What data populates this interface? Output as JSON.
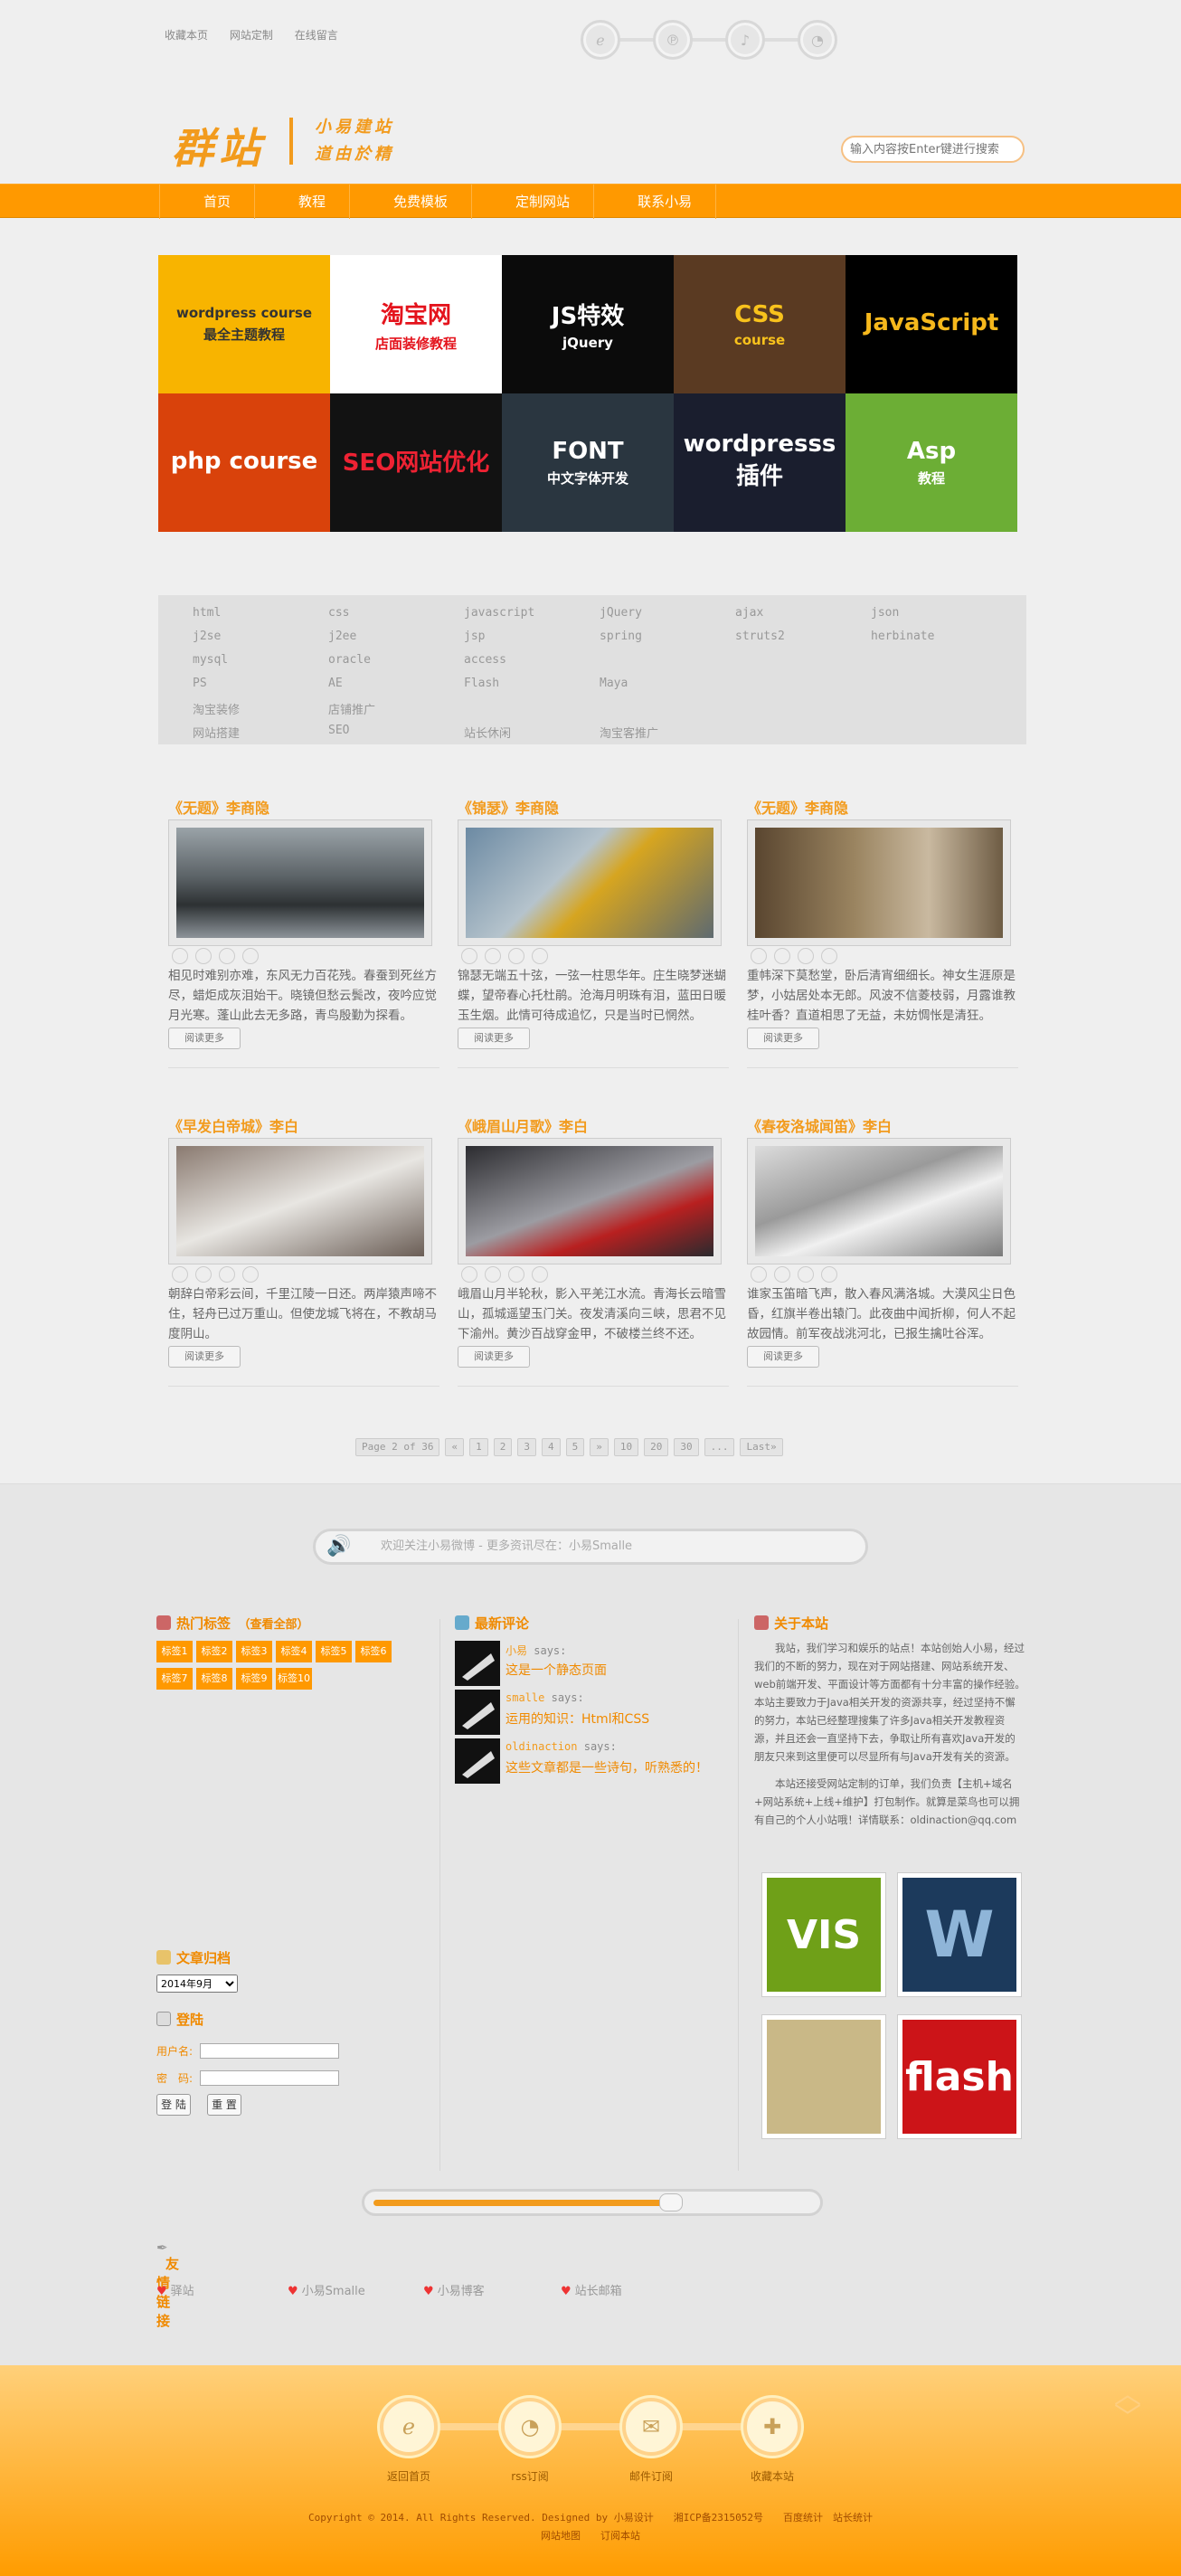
{
  "top_links": [
    "收藏本页",
    "网站定制",
    "在线留言"
  ],
  "top_icons": [
    "ie-icon",
    "p-icon",
    "bell-icon",
    "rss-icon"
  ],
  "logo": {
    "big": "群站",
    "line1": "小易建站",
    "line2": "道由於精"
  },
  "search": {
    "placeholder": "输入内容按Enter键进行搜索"
  },
  "nav": [
    "首页",
    "教程",
    "免费模板",
    "定制网站",
    "联系小易"
  ],
  "tiles": [
    {
      "l1": "wordpress course",
      "l2": "最全主题教程",
      "bg": "#f8b400",
      "fg": "#333"
    },
    {
      "l1": "淘宝网",
      "l2": "店面装修教程",
      "bg": "#ffffff",
      "fg": "#e4131c"
    },
    {
      "l1": "JS特效",
      "l2": "jQuery",
      "bg": "#0b0b0b",
      "fg": "#ffffff"
    },
    {
      "l1": "CSS",
      "l2": "course",
      "bg": "#5a3a22",
      "fg": "#f8c21c"
    },
    {
      "l1": "JavaScript",
      "l2": "",
      "bg": "#000000",
      "fg": "#f6b81c"
    },
    {
      "l1": "php course",
      "l2": "",
      "bg": "#d9420b",
      "fg": "#ffffff"
    },
    {
      "l1": "SEO网站优化",
      "l2": "",
      "bg": "#121212",
      "fg": "#e23"
    },
    {
      "l1": "FONT",
      "l2": "中文字体开发",
      "bg": "#2a3640",
      "fg": "#ffffff"
    },
    {
      "l1": "wordpresss插件",
      "l2": "",
      "bg": "#1a1e2e",
      "fg": "#ffffff"
    },
    {
      "l1": "Asp",
      "l2": "教程",
      "bg": "#6cae35",
      "fg": "#ffffff"
    }
  ],
  "tag_rows": [
    [
      "html",
      "css",
      "javascript",
      "jQuery",
      "ajax",
      "json"
    ],
    [
      "j2se",
      "j2ee",
      "jsp",
      "spring",
      "struts2",
      "herbinate"
    ],
    [
      "mysql",
      "oracle",
      "access",
      "",
      "",
      ""
    ],
    [
      "PS",
      "AE",
      "Flash",
      "Maya",
      "",
      ""
    ],
    [
      "淘宝装修",
      "店铺推广",
      "",
      "",
      "",
      ""
    ],
    [
      "网站搭建",
      "SEO",
      "站长休闲",
      "淘宝客推广",
      "",
      ""
    ]
  ],
  "posts": [
    {
      "title": "《无题》李商隐",
      "excerpt": "相见时难别亦难，东风无力百花残。春蚕到死丝方尽，蜡炬成灰泪始干。晓镜但愁云鬓改，夜吟应觉月光寒。蓬山此去无多路，青鸟殷勤为探看。",
      "more": "阅读更多",
      "img": "linear-gradient(#9aa3a8,#5b6266 45%,#2d3133 70%,#8d949a)"
    },
    {
      "title": "《锦瑟》李商隐",
      "excerpt": "锦瑟无端五十弦，一弦一柱思华年。庄生晓梦迷蝴蝶，望帝春心托杜鹃。沧海月明珠有泪，蓝田日暖玉生烟。此情可待成追忆，只是当时已惘然。",
      "more": "阅读更多",
      "img": "linear-gradient(135deg,#6c8aa3,#b5c3cc 40%,#d6a520 55%,#5e6a70)"
    },
    {
      "title": "《无题》李商隐",
      "excerpt": "重帏深下莫愁堂，卧后清宵细细长。神女生涯原是梦，小姑居处本无郎。风波不信菱枝弱，月露谁教桂叶香？直道相思了无益，未妨惆怅是清狂。",
      "more": "阅读更多",
      "img": "linear-gradient(90deg,#5a4630,#9a8460 40%,#c9b9a0 70%,#6e5c44)"
    },
    {
      "title": "《早发白帝城》李白",
      "excerpt": "朝辞白帝彩云间，千里江陵一日还。两岸猿声啼不住，轻舟已过万重山。但使龙城飞将在，不教胡马度阴山。",
      "more": "阅读更多",
      "img": "linear-gradient(160deg,#8a7a70,#e8e6e2 50%,#6b5e56)"
    },
    {
      "title": "《峨眉山月歌》李白",
      "excerpt": "峨眉山月半轮秋，影入平羌江水流。青海长云暗雪山，孤城遥望玉门关。夜发清溪向三峡，思君不见下渝州。黄沙百战穿金甲，不破楼兰终不还。",
      "more": "阅读更多",
      "img": "linear-gradient(160deg,#2c2c30,#9c9ca2 50%,#b82020 70%,#2a2a2e)"
    },
    {
      "title": "《春夜洛城闻笛》李白",
      "excerpt": "谁家玉笛暗飞声，散入春风满洛城。大漠风尘日色昏，红旗半卷出辕门。此夜曲中闻折柳，何人不起故园情。前军夜战洮河北，已报生擒吐谷浑。",
      "more": "阅读更多",
      "img": "linear-gradient(160deg,#dcdcdc,#9a9a9a 40%,#f0f0f0 60%,#7a7a7a)"
    }
  ],
  "pager": [
    "Page 2 of 36",
    "«",
    "1",
    "2",
    "3",
    "4",
    "5",
    "»",
    "10",
    "20",
    "30",
    "...",
    "Last»"
  ],
  "weibo": "欢迎关注小易微博 - 更多资讯尽在：小易Smalle",
  "hot_tags": {
    "title": "热门标签",
    "all": "（查看全部）",
    "chips": [
      "标签1",
      "标签2",
      "标签3",
      "标签4",
      "标签5",
      "标签6",
      "标签7",
      "标签8",
      "标签9",
      "标签10"
    ]
  },
  "comments": {
    "title": "最新评论",
    "items": [
      {
        "name": "小易",
        "says": "says:",
        "text": "这是一个静态页面"
      },
      {
        "name": "smalle",
        "says": "says:",
        "text": "运用的知识：Html和CSS"
      },
      {
        "name": "oldinaction",
        "says": "says:",
        "text": "这些文章都是一些诗句，听熟悉的！"
      }
    ]
  },
  "about": {
    "title": "关于本站",
    "p1": "　　我站，我们学习和娱乐的站点！本站创始人小易，经过我们的不断的努力，现在对于网站搭建、网站系统开发、web前端开发、平面设计等方面都有十分丰富的操作经验。本站主要致力于Java相关开发的资源共享，经过坚持不懈的努力，本站已经整理搜集了许多Java相关开发教程资源，并且还会一直坚持下去，争取让所有喜欢Java开发的朋友只来到这里便可以尽显所有与Java开发有关的资源。",
    "p2": "　　本站还接受网站定制的订单，我们负责【主机+域名+网站系统+上线+维护】打包制作。就算是菜鸟也可以拥有自己的个人小站哦！详情联系：oldinaction@qq.com",
    "thumbs": [
      {
        "label": "VIS",
        "bg": "#6fa018",
        "fg": "#fff"
      },
      {
        "label": "W",
        "bg": "#1c3a5c",
        "fg": "#8fb5d8"
      },
      {
        "label": "",
        "bg": "#c9b887",
        "fg": "#2a6"
      },
      {
        "label": "flash",
        "bg": "#cc1418",
        "fg": "#fff"
      }
    ]
  },
  "archive": {
    "title": "文章归档",
    "select": "2014年9月"
  },
  "login": {
    "title": "登陆",
    "user": "用户名:",
    "pass": "密　码:",
    "login_btn": "登 陆",
    "reset_btn": "重 置"
  },
  "slider_value": 0.66,
  "friend_links": {
    "title": "友情链接",
    "items": [
      "驿站",
      "小易Smalle",
      "小易博客",
      "站长邮箱"
    ]
  },
  "footer": {
    "icons": [
      {
        "label": "返回首页",
        "icon": "e-icon"
      },
      {
        "label": "rss订阅",
        "icon": "rss-icon"
      },
      {
        "label": "邮件订阅",
        "icon": "mail-icon"
      },
      {
        "label": "收藏本站",
        "icon": "plus-icon"
      }
    ],
    "copy1": "Copyright © 2014. All Rights Reserved. Designed by 小易设计　　湘ICP备2315052号　　百度统计　站长统计",
    "copy2": "网站地图　　订阅本站"
  }
}
